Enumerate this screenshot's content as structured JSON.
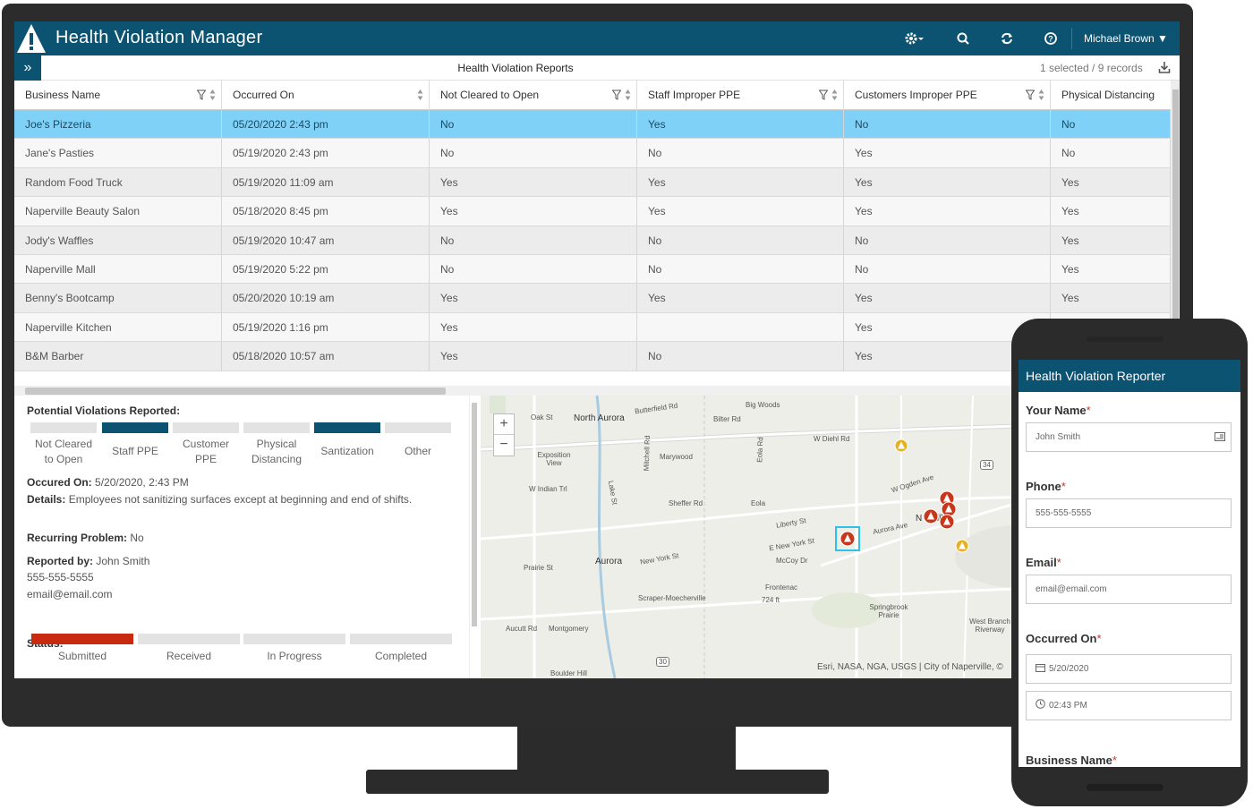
{
  "app": {
    "title": "Health Violation Manager",
    "user": "Michael Brown ▼",
    "accent_color": "#0c5271",
    "icons": [
      "gear-icon",
      "search-icon",
      "refresh-icon",
      "help-icon"
    ]
  },
  "table": {
    "title": "Health Violation Reports",
    "count": "1 selected / 9 records",
    "columns": [
      "Business Name",
      "Occurred On",
      "Not Cleared to Open",
      "Staff Improper PPE",
      "Customers Improper PPE",
      "Physical Distancing"
    ],
    "rows": [
      [
        "Joe's Pizzeria",
        "05/20/2020 2:43 pm",
        "No",
        "Yes",
        "No",
        "No"
      ],
      [
        "Jane's Pasties",
        "05/19/2020 2:43 pm",
        "No",
        "No",
        "Yes",
        "No"
      ],
      [
        "Random Food Truck",
        "05/19/2020 11:09 am",
        "Yes",
        "Yes",
        "Yes",
        "Yes"
      ],
      [
        "Naperville Beauty Salon",
        "05/18/2020 8:45 pm",
        "Yes",
        "Yes",
        "Yes",
        "Yes"
      ],
      [
        "Jody's Waffles",
        "05/19/2020 10:47 am",
        "No",
        "No",
        "No",
        "Yes"
      ],
      [
        "Naperville Mall",
        "05/19/2020 5:22 pm",
        "No",
        "No",
        "No",
        "Yes"
      ],
      [
        "Benny's Bootcamp",
        "05/20/2020 10:19 am",
        "Yes",
        "Yes",
        "Yes",
        "Yes"
      ],
      [
        "Naperville Kitchen",
        "05/19/2020 1:16 pm",
        "Yes",
        "",
        "Yes",
        ""
      ],
      [
        "B&M Barber",
        "05/18/2020 10:57 am",
        "Yes",
        "No",
        "Yes",
        ""
      ]
    ],
    "selected_row": 0,
    "selected_color": "#7fd1f7"
  },
  "details": {
    "violations_heading": "Potential Violations Reported:",
    "violations": [
      {
        "label": "Not Cleared to Open",
        "active": false
      },
      {
        "label": "Staff PPE",
        "active": true
      },
      {
        "label": "Customer PPE",
        "active": false
      },
      {
        "label": "Physical Distancing",
        "active": false
      },
      {
        "label": "Santization",
        "active": true
      },
      {
        "label": "Other",
        "active": false
      }
    ],
    "occurred_label": "Occured On:",
    "occurred_value": "5/20/2020, 2:43 PM",
    "details_label": "Details:",
    "details_value": "Employees not sanitizing surfaces except at beginning and end of shifts.",
    "recurring_label": "Recurring Problem:",
    "recurring_value": "No",
    "reported_label": "Reported by:",
    "reported_value": "John Smith",
    "phone": "555-555-5555",
    "email": "email@email.com",
    "status_label": "Status:",
    "statuses": [
      {
        "label": "Submitted",
        "active": true
      },
      {
        "label": "Received",
        "active": false
      },
      {
        "label": "In Progress",
        "active": false
      },
      {
        "label": "Completed",
        "active": false
      }
    ],
    "active_segment_color": "#0c5271",
    "status_active_color": "#c8290f"
  },
  "map": {
    "zoom_in": "+",
    "zoom_out": "−",
    "attribution": "Esri, NASA, NGA, USGS | City of Naperville, ©",
    "labels": {
      "north_aurora": "North Aurora",
      "aurora": "Aurora",
      "eola": "Eola",
      "frontenac": "Frontenac",
      "montgomery": "Montgomery",
      "marywood": "Marywood",
      "big_woods": "Big Woods",
      "exposition_view": "Exposition View",
      "sheffer_rd": "Sheffer Rd",
      "scraper": "Scraper-Moecherville",
      "springbrook": "Springbrook Prairie",
      "west_branch": "West Branch Riverway",
      "naperville": "N      ille",
      "butterfield": "Butterfield Rd",
      "w_indian_trl": "W Indian Trl",
      "prairie_st": "Prairie St",
      "new_york_st": "New York St",
      "e_new_york_st": "E New York St",
      "liberty_st": "Liberty St",
      "aurora_ave": "Aurora Ave",
      "w_ogden_ave": "W Ogden Ave",
      "w_diehl_rd": "W Diehl Rd",
      "oak_st": "Oak St",
      "boulder_hill": "Boulder Hill",
      "mccoy_dr": "McCoy Dr",
      "aucutt_rd": "Aucutt Rd",
      "bilter_rd": "Bilter Rd",
      "rd_724": "724 ft",
      "route_34": "34",
      "route_30": "30",
      "lake_st": "Lake St",
      "mitchell_rd": "Mitchell Rd",
      "eola_rd": "Eola Rd"
    }
  },
  "phone": {
    "title": "Health Violation Reporter",
    "fields": [
      {
        "label": "Your Name",
        "value": "John Smith"
      },
      {
        "label": "Phone",
        "value": "555-555-5555"
      },
      {
        "label": "Email",
        "value": "email@email.com"
      },
      {
        "label": "Occurred On",
        "value": "5/20/2020",
        "value2": "02:43 PM"
      },
      {
        "label": "Business Name",
        "value": ""
      }
    ],
    "required_mark": "*"
  }
}
